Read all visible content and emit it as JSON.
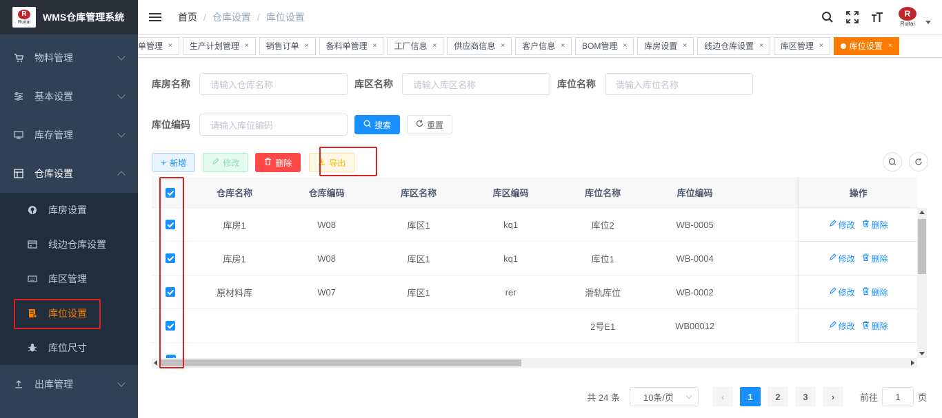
{
  "app": {
    "title": "WMS仓库管理系统",
    "logo_text": "Ruitai",
    "logo_mark": "R"
  },
  "sidebar": {
    "items": [
      {
        "label": "物料管理",
        "icon": "cart-icon"
      },
      {
        "label": "基本设置",
        "icon": "sliders-icon"
      },
      {
        "label": "库存管理",
        "icon": "monitor-icon"
      },
      {
        "label": "仓库设置",
        "icon": "grid-icon",
        "expanded": true
      },
      {
        "label": "出库管理",
        "icon": "upload-icon"
      }
    ],
    "sub_items": [
      {
        "label": "库房设置",
        "icon": "github-icon"
      },
      {
        "label": "线边仓库设置",
        "icon": "card-icon"
      },
      {
        "label": "库区管理",
        "icon": "keyboard-icon"
      },
      {
        "label": "库位设置",
        "icon": "storage-icon",
        "active": true
      },
      {
        "label": "库位尺寸",
        "icon": "bug-icon"
      }
    ]
  },
  "breadcrumb": [
    "首页",
    "仓库设置",
    "库位设置"
  ],
  "tags": [
    {
      "label": "清单管理"
    },
    {
      "label": "生产计划管理"
    },
    {
      "label": "销售订单"
    },
    {
      "label": "备料单管理"
    },
    {
      "label": "工厂信息"
    },
    {
      "label": "供应商信息"
    },
    {
      "label": "客户信息"
    },
    {
      "label": "BOM管理"
    },
    {
      "label": "库房设置"
    },
    {
      "label": "线边仓库设置"
    },
    {
      "label": "库区管理"
    },
    {
      "label": "库位设置",
      "active": true
    }
  ],
  "search": {
    "warehouse_name_label": "库房名称",
    "warehouse_name_placeholder": "请输入仓库名称",
    "area_name_label": "库区名称",
    "area_name_placeholder": "请输入库区名称",
    "location_name_label": "库位名称",
    "location_name_placeholder": "请输入库位名称",
    "location_code_label": "库位编码",
    "location_code_placeholder": "请输入库位编码",
    "search_btn": "搜索",
    "reset_btn": "重置"
  },
  "toolbar": {
    "add": "新增",
    "edit": "修改",
    "delete": "删除",
    "export": "导出"
  },
  "table": {
    "columns": [
      "仓库名称",
      "仓库编码",
      "库区名称",
      "库区编码",
      "库位名称",
      "库位编码",
      "",
      "操作"
    ],
    "rows": [
      {
        "warehouse": "库房1",
        "warehouse_code": "W08",
        "area": "库区1",
        "area_code": "kq1",
        "location": "库位2",
        "location_code": "WB-0005"
      },
      {
        "warehouse": "库房1",
        "warehouse_code": "W08",
        "area": "库区1",
        "area_code": "kq1",
        "location": "库位1",
        "location_code": "WB-0004"
      },
      {
        "warehouse": "原材料库",
        "warehouse_code": "W07",
        "area": "库区1",
        "area_code": "rer",
        "location": "滑轨库位",
        "location_code": "WB-0002"
      },
      {
        "warehouse": "",
        "warehouse_code": "",
        "area": "",
        "area_code": "",
        "location": "2号E1",
        "location_code": "WB00012"
      }
    ],
    "row_actions": {
      "edit": "修改",
      "delete": "删除"
    }
  },
  "pagination": {
    "total": "共 24 条",
    "page_size": "10条/页",
    "pages": [
      "1",
      "2",
      "3"
    ],
    "current": "1",
    "goto_label": "前往",
    "goto_value": "1",
    "page_suffix": "页"
  },
  "colors": {
    "primary": "#1890ff",
    "accent": "#ff7a00",
    "danger": "#ff4949",
    "sidebar": "#304156",
    "highlight_box": "#e02020"
  }
}
